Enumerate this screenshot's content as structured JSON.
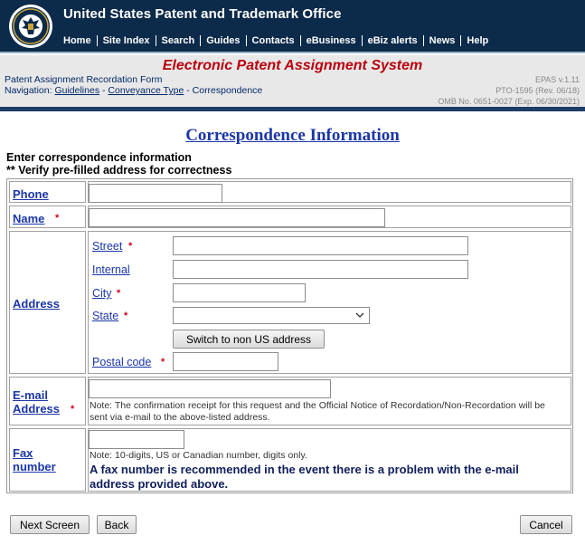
{
  "header": {
    "org_title": "United States Patent and Trademark Office",
    "nav": [
      "Home",
      "Site Index",
      "Search",
      "Guides",
      "Contacts",
      "eBusiness",
      "eBiz alerts",
      "News",
      "Help"
    ],
    "seal_icon": "uspto-seal-icon"
  },
  "subheader": {
    "system_title": "Electronic Patent Assignment System",
    "form_name": "Patent Assignment Recordation Form",
    "nav_prefix": "Navigation:",
    "nav_guidelines": "Guidelines",
    "nav_sep": "-",
    "nav_conveyance": "Conveyance Type",
    "nav_current": "Correspondence",
    "meta_version": "EPAS v.1.11",
    "meta_pto": "PTO-1595 (Rev. 06/18)",
    "meta_omb": "OMB No. 0651-0027 (Exp. 06/30/2021)"
  },
  "page": {
    "title": "Correspondence Information",
    "instruction1": "Enter correspondence information",
    "instruction2": "** Verify pre-filled address for correctness"
  },
  "form": {
    "required_mark": "*",
    "phone_label": "Phone",
    "phone_value": "",
    "name_label": "Name",
    "name_value": "",
    "address_label": "Address",
    "street_label": "Street",
    "street_value": "",
    "internal_label": "Internal",
    "internal_value": "",
    "city_label": "City",
    "city_value": "",
    "state_label": "State",
    "state_value": "",
    "switch_button": "Switch to non US address",
    "postal_label": "Postal code",
    "postal_value": "",
    "email_label_line1": "E-mail",
    "email_label_line2": "Address",
    "email_value": "",
    "email_note": "Note: The confirmation receipt for this request and the Official Notice of Recordation/Non-Recordation will be sent via e-mail to the above-listed address.",
    "fax_label_line1": "Fax",
    "fax_label_line2": "number",
    "fax_value": "",
    "fax_note": "Note: 10-digits, US or Canadian number, digits only.",
    "fax_recommend": "A fax number is recommended in the event there is a problem with the e-mail address provided above."
  },
  "actions": {
    "next": "Next Screen",
    "back": "Back",
    "cancel": "Cancel"
  },
  "colors": {
    "header_bg": "#0c2a4a",
    "system_title": "#b8000e",
    "link": "#1b36a8",
    "required": "#d0001a"
  }
}
